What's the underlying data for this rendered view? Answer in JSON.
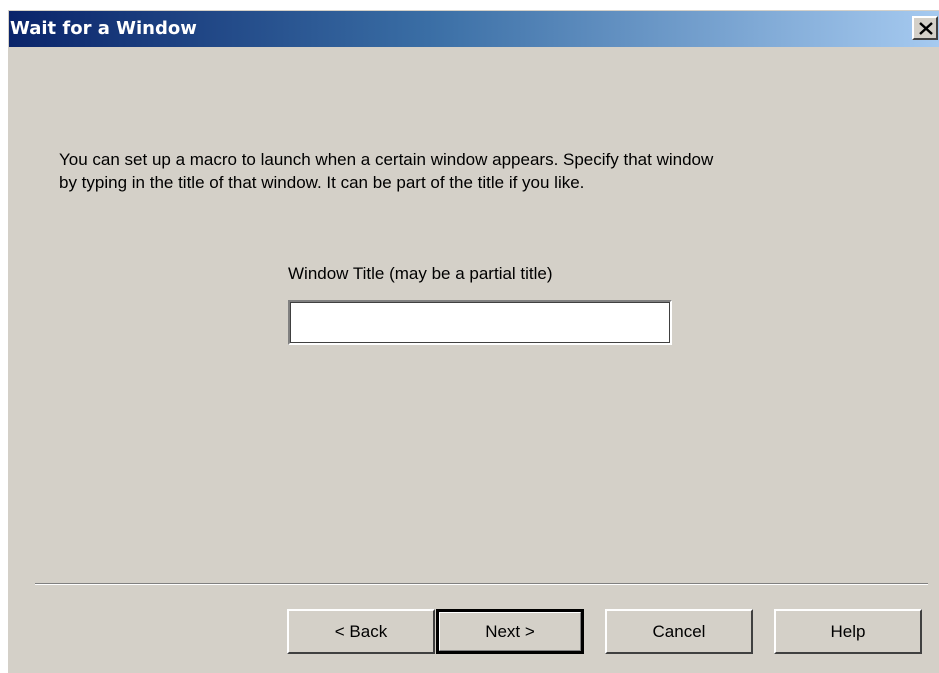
{
  "window": {
    "title": "Wait for a Window",
    "close_icon": "close-icon"
  },
  "intro": {
    "line1": "You can set up a macro to launch when a certain window appears.  Specify that window",
    "line2": "by typing in the title of that window.  It can be part of the title if you like."
  },
  "form": {
    "label": "Window Title (may be a partial title)",
    "value": "",
    "placeholder": ""
  },
  "buttons": {
    "back": "< Back",
    "next": "Next >",
    "cancel": "Cancel",
    "help": "Help"
  },
  "colors": {
    "titlebar_start": "#0a246a",
    "titlebar_end": "#a6caf0",
    "dialog_bg": "#d4d0c8"
  }
}
